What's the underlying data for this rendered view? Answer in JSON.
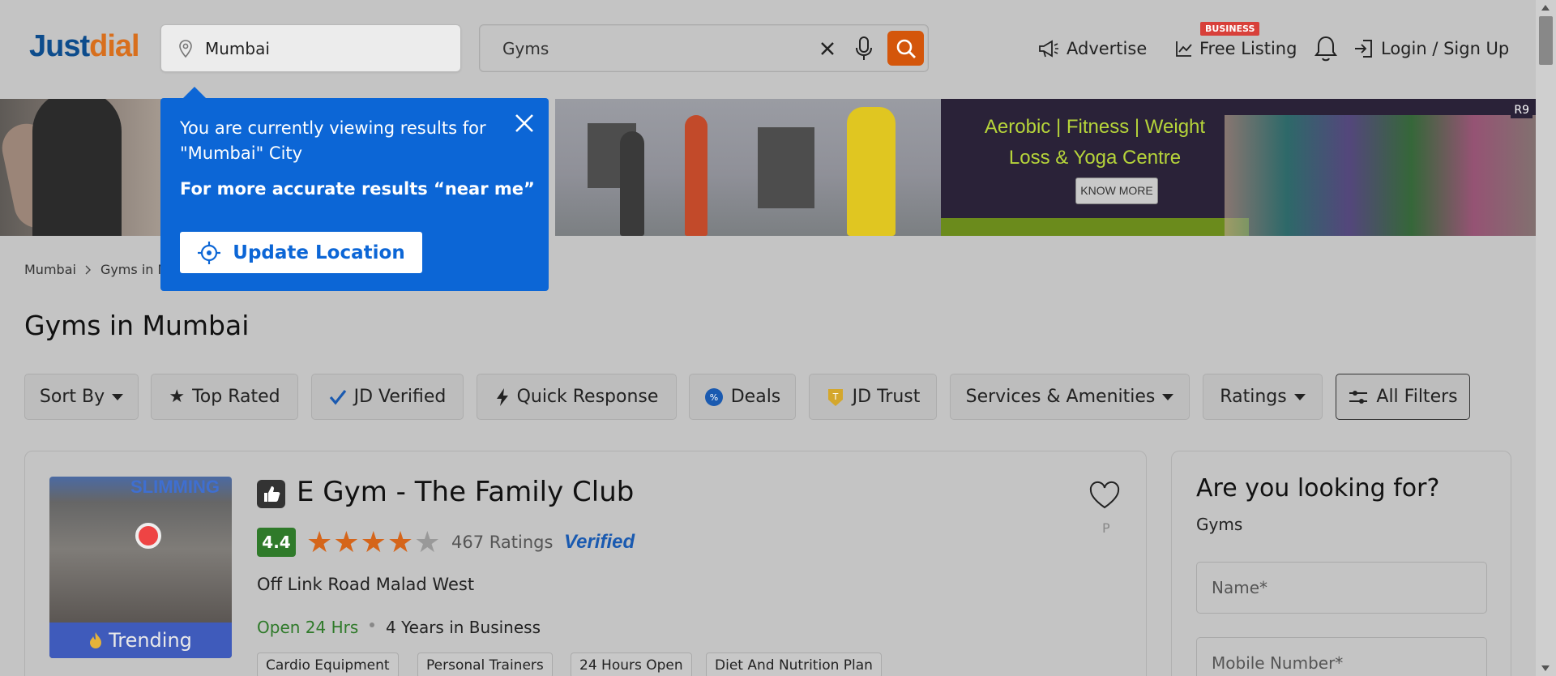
{
  "header": {
    "logo_part1": "Just",
    "logo_part2": "dial",
    "location_value": "Mumbai",
    "search_value": "Gyms",
    "advertise_label": "Advertise",
    "free_listing_label": "Free Listing",
    "business_badge": "BUSINESS",
    "login_label": "Login / Sign Up"
  },
  "banner": {
    "headline_line1": "Aerobic | Fitness | Weight",
    "headline_line2": "Loss & Yoga Centre",
    "cta_label": "KNOW MORE",
    "corner_tag": "R9"
  },
  "tooltip": {
    "line1": "You are currently viewing results for \"Mumbai\" City",
    "line2": "For more accurate results “near me”",
    "button_label": "Update Location"
  },
  "breadcrumb": {
    "items": [
      "Mumbai",
      "Gyms in M"
    ]
  },
  "page_title": "Gyms in Mumbai",
  "filters": [
    {
      "label": "Sort By"
    },
    {
      "label": "Top Rated"
    },
    {
      "label": "JD Verified"
    },
    {
      "label": "Quick Response"
    },
    {
      "label": "Deals"
    },
    {
      "label": "JD Trust"
    },
    {
      "label": "Services & Amenities"
    },
    {
      "label": "Ratings"
    },
    {
      "label": "All Filters"
    }
  ],
  "listing": {
    "name": "E Gym - The Family Club",
    "rating": "4.4",
    "rating_value": 4.4,
    "rating_count": "467 Ratings",
    "verified_label": "Verified",
    "address": "Off Link Road Malad West",
    "open_status": "Open 24 Hrs",
    "years": "4 Years in Business",
    "trending_label": "Trending",
    "thumb_sign": "SLIMMING",
    "p_label": "P",
    "tags": [
      "Cardio Equipment",
      "Personal Trainers",
      "24 Hours Open",
      "Diet And Nutrition Plan"
    ]
  },
  "side_panel": {
    "title": "Are you looking for?",
    "subtitle": "Gyms",
    "name_placeholder": "Name*",
    "mobile_placeholder": "Mobile Number*"
  },
  "colors": {
    "brand_blue": "#0d4c8c",
    "brand_orange": "#d86f1d",
    "search_button": "#d4560b",
    "tooltip_blue": "#0c66d6",
    "rating_green": "#2f7a2a",
    "badge_red": "#d8403a"
  }
}
